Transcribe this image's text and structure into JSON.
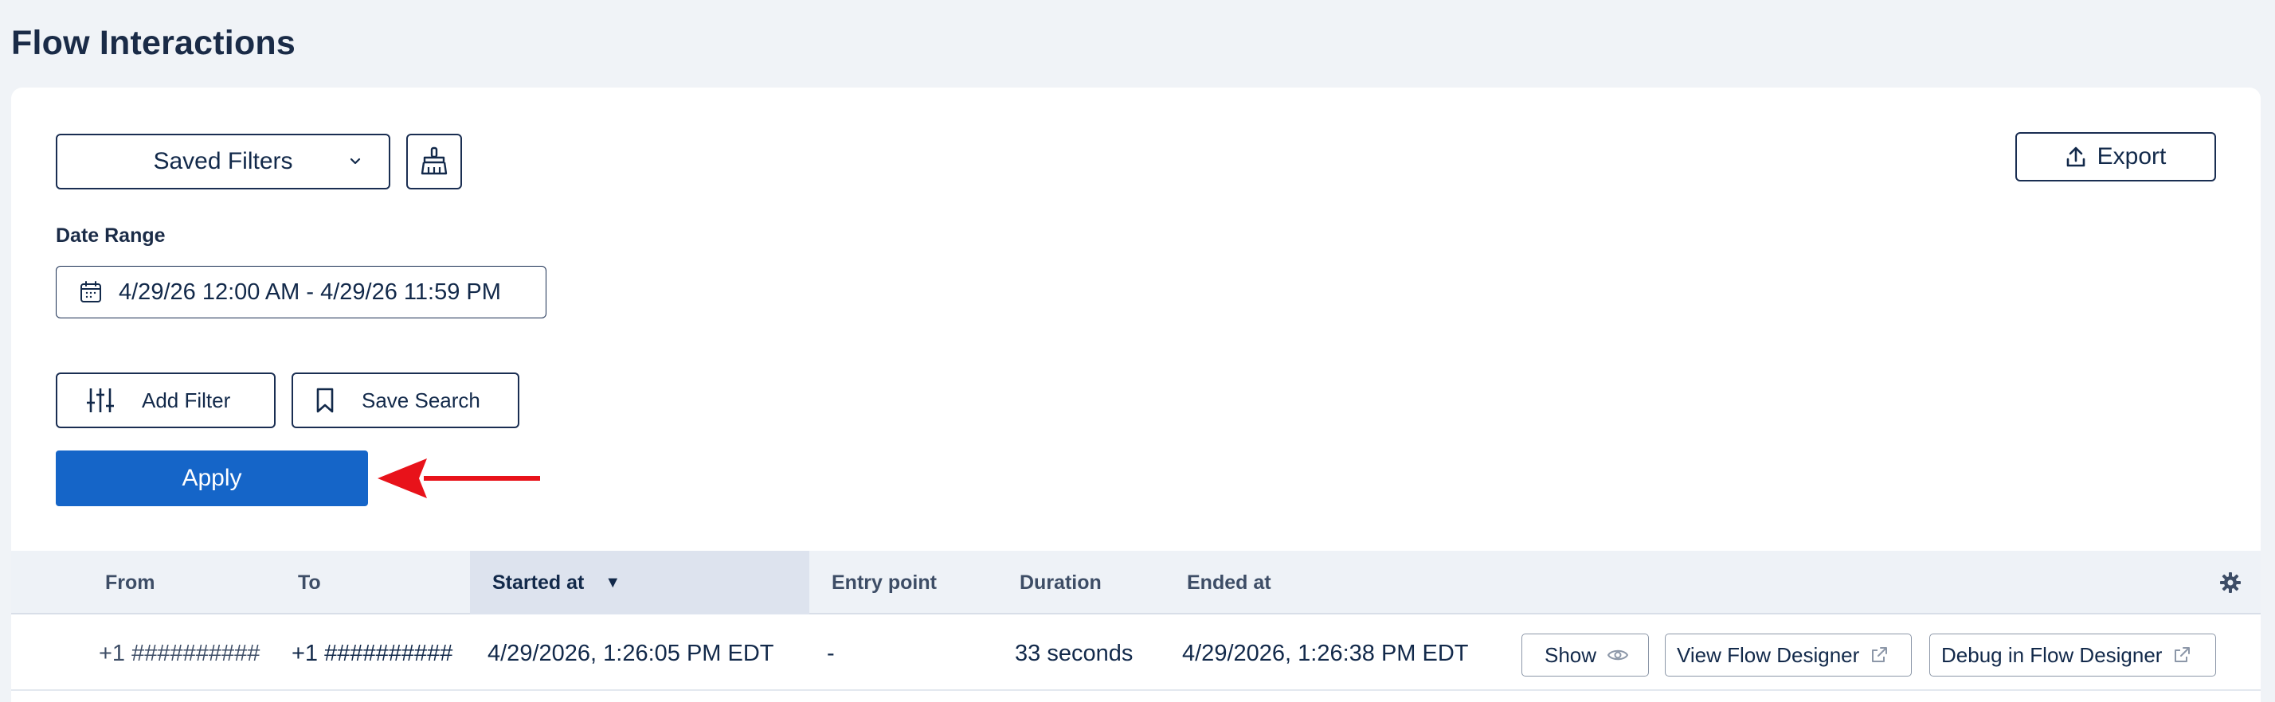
{
  "page": {
    "title": "Flow Interactions"
  },
  "toolbar": {
    "saved_filters_label": "Saved Filters",
    "export_label": "Export"
  },
  "filters": {
    "date_range_label": "Date Range",
    "date_range_value": "4/29/26 12:00 AM - 4/29/26 11:59 PM",
    "add_filter_label": "Add Filter",
    "save_search_label": "Save Search",
    "apply_label": "Apply"
  },
  "table": {
    "columns": [
      "From",
      "To",
      "Started at",
      "Entry point",
      "Duration",
      "Ended at"
    ],
    "sorted_column": "Started at",
    "rows": [
      {
        "from": "+1 ##########",
        "to": "+1 ##########",
        "started_at": "4/29/2026, 1:26:05 PM EDT",
        "entry_point": "-",
        "duration": "33 seconds",
        "ended_at": "4/29/2026, 1:26:38 PM EDT",
        "actions": {
          "show": "Show",
          "view_flow_designer": "View Flow Designer",
          "debug_flow_designer": "Debug in Flow Designer"
        }
      }
    ]
  },
  "colors": {
    "primary": "#1565c8",
    "annotation_arrow": "#e8121a",
    "text_dark": "#12294a"
  }
}
